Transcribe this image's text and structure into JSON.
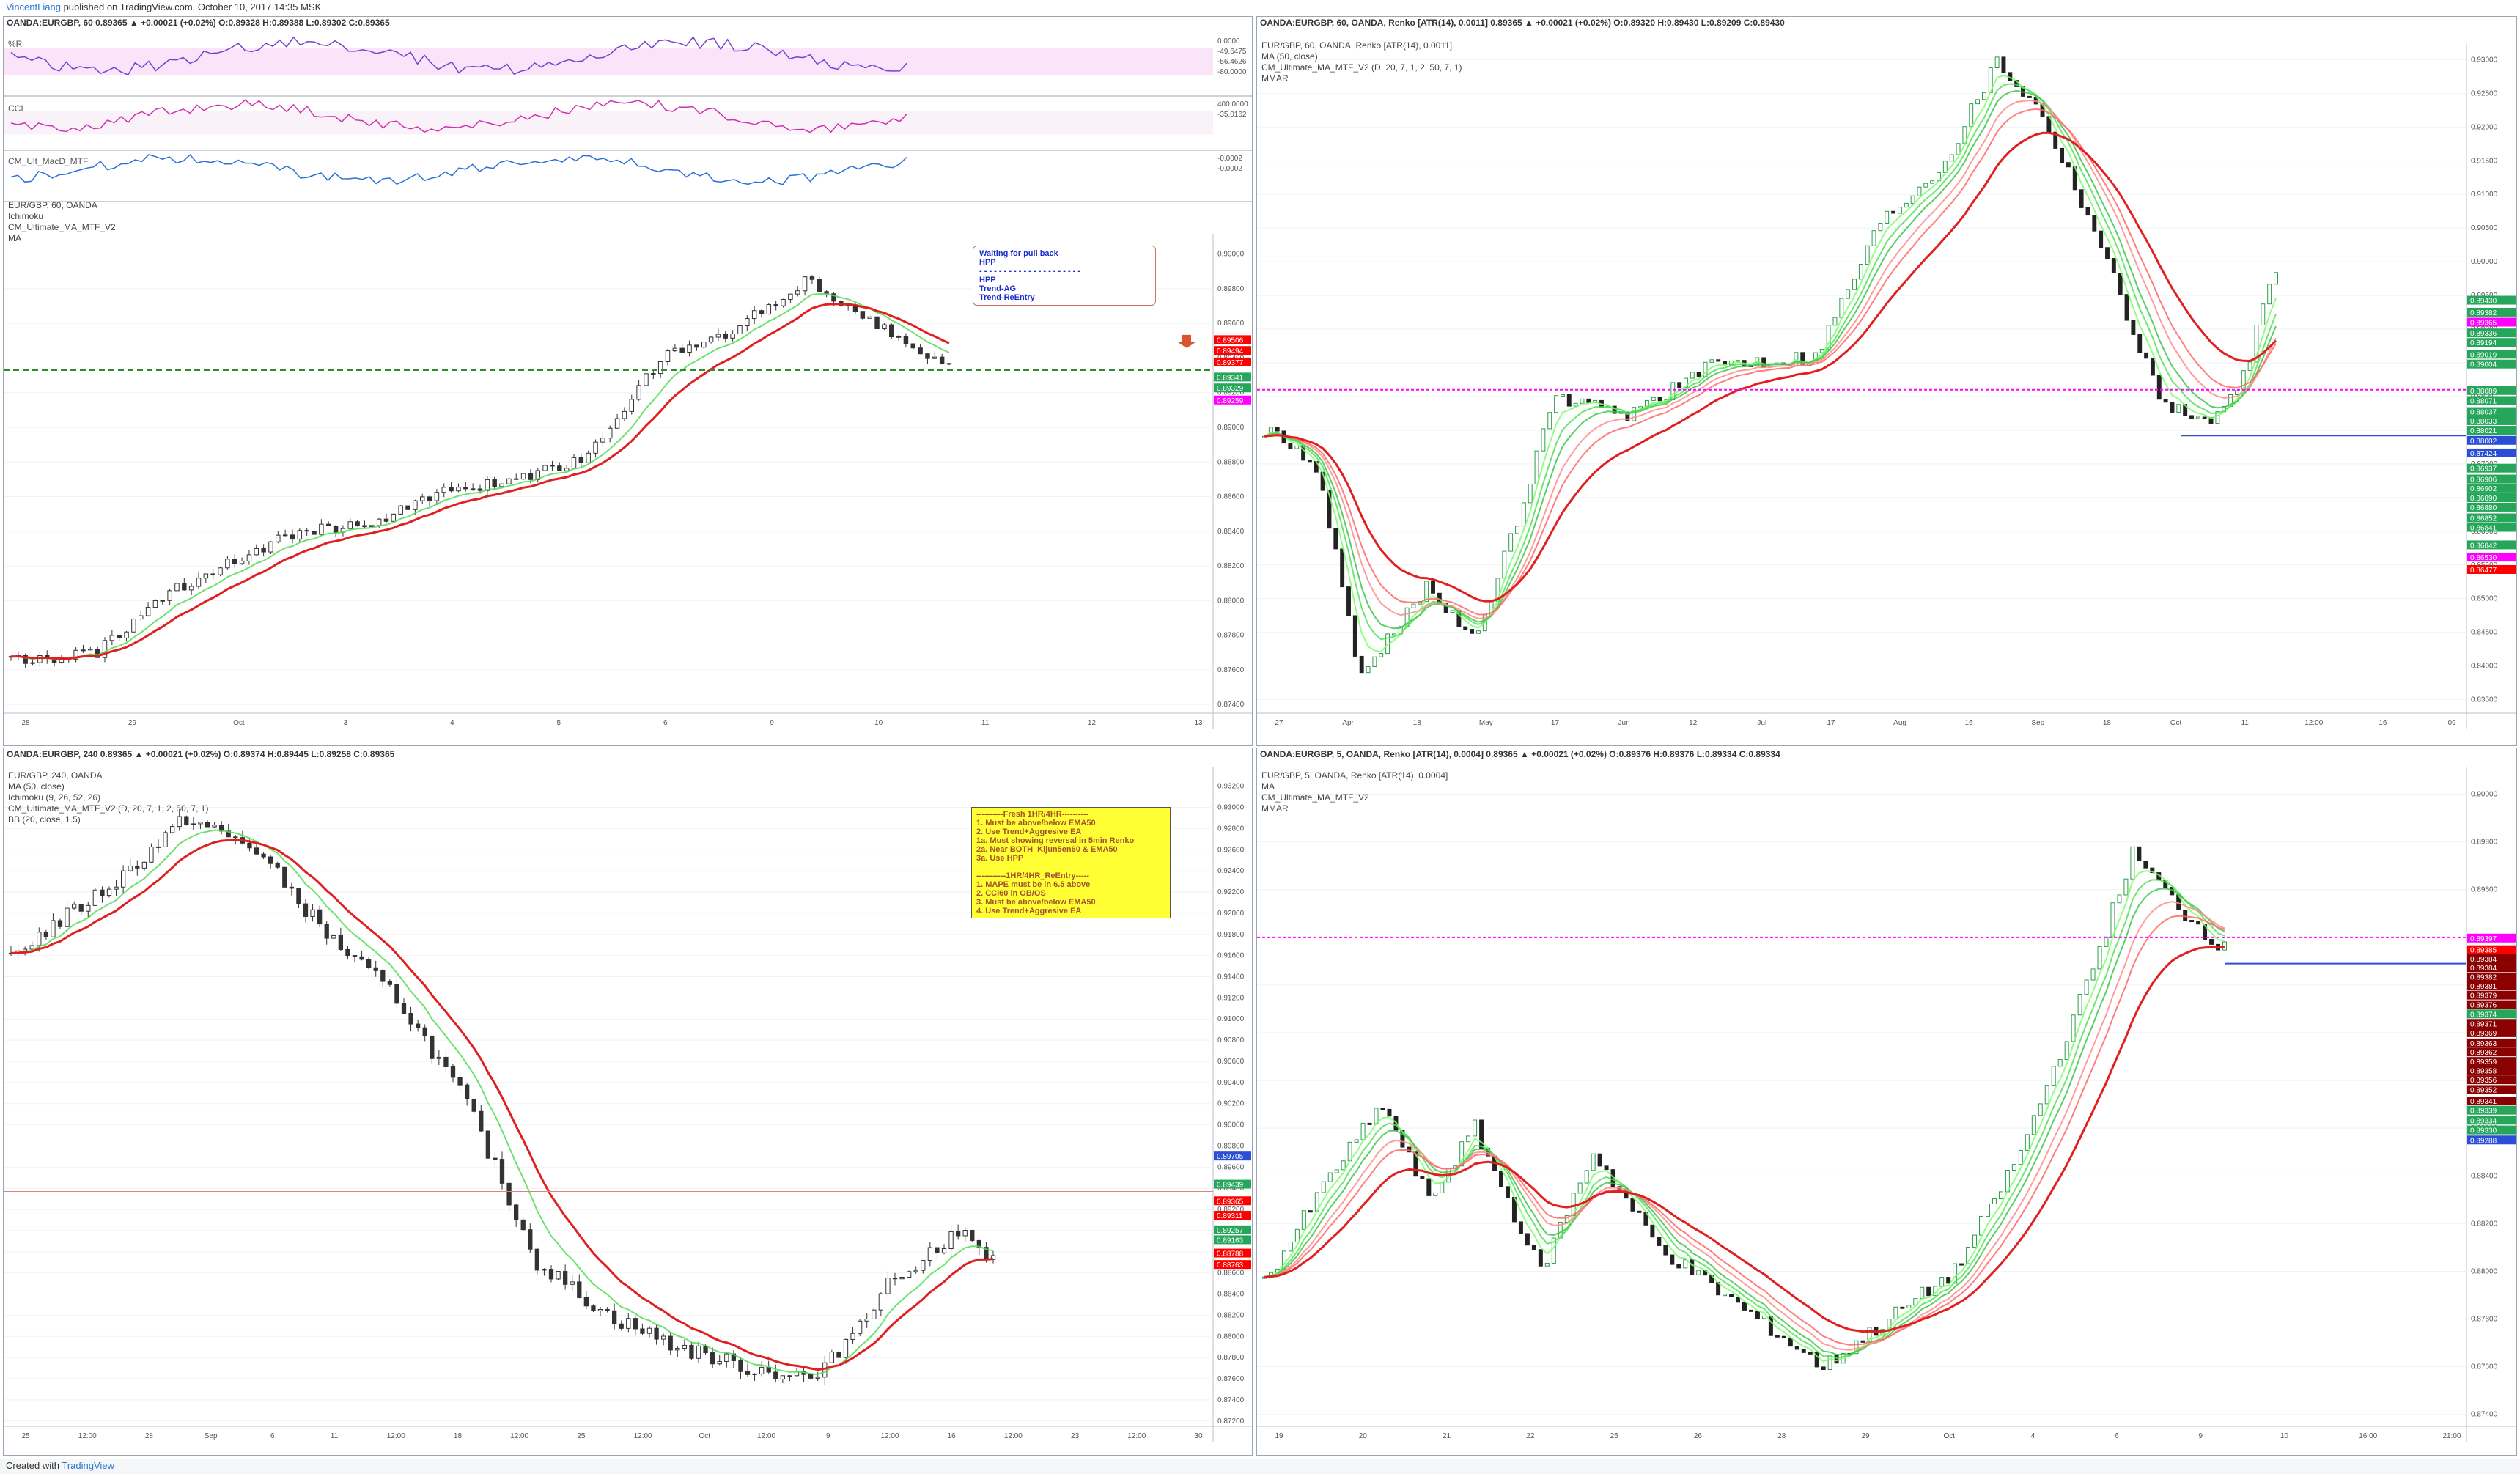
{
  "header": {
    "user": "VincentLiang",
    "text": "published on TradingView.com, October 10, 2017 14:35 MSK"
  },
  "footer": {
    "created": "Created with",
    "brand": "TradingView"
  },
  "panels": {
    "tl": {
      "ohlc": "OANDA:EURGBP, 60 0.89365 ▲ +0.00021 (+0.02%) O:0.89328 H:0.89388 L:0.89302 C:0.89365",
      "legend": [
        "EUR/GBP, 60, OANDA",
        "Ichimoku",
        "CM_Ultimate_MA_MTF_V2",
        "MA"
      ],
      "sub": {
        "wr": "%R",
        "cci": "CCI",
        "macd": "CM_Ult_MacD_MTF"
      },
      "note": "Waiting for pull back\nHPP\n- - - - - - - - - - - - - - - - - - - - -\nHPP\nTrend-AG\nTrend-ReEntry"
    },
    "tr": {
      "ohlc": "OANDA:EURGBP, 60, OANDA, Renko [ATR(14), 0.0011] 0.89365 ▲ +0.00021 (+0.02%) O:0.89320 H:0.89430 L:0.89209 C:0.89430",
      "legend": [
        "EUR/GBP, 60, OANDA, Renko [ATR(14), 0.0011]",
        "MA (50, close)",
        "CM_Ultimate_MA_MTF_V2 (D, 20, 7, 1, 2, 50, 7, 1)",
        "MMAR"
      ]
    },
    "bl": {
      "ohlc": "OANDA:EURGBP, 240 0.89365 ▲ +0.00021 (+0.02%) O:0.89374 H:0.89445 L:0.89258 C:0.89365",
      "legend": [
        "EUR/GBP, 240, OANDA",
        "MA (50, close)",
        "Ichimoku (9, 26, 52, 26)",
        "CM_Ultimate_MA_MTF_V2 (D, 20, 7, 1, 2, 50, 7, 1)",
        "BB (20, close, 1.5)"
      ],
      "note": "----------Fresh 1HR/4HR----------\n1. Must be above/below EMA50\n2. Use Trend+Aggresive EA\n1a. Must showing reversal in 5min Renko\n2a. Near BOTH  Kijun5en60 & EMA50\n3a. Use HPP\n\n-----------1HR/4HR_ReEntry-----\n1. MAPE must be in 6.5 above\n2. CCI60 in OB/OS\n3. Must be above/below EMA50\n4. Use Trend+Aggresive EA"
    },
    "br": {
      "ohlc": "OANDA:EURGBP, 5, OANDA, Renko [ATR(14), 0.0004] 0.89365 ▲ +0.00021 (+0.02%) O:0.89376 H:0.89376 L:0.89334 C:0.89334",
      "legend": [
        "EUR/GBP, 5, OANDA, Renko [ATR(14), 0.0004]",
        "MA",
        "CM_Ultimate_MA_MTF_V2",
        "MMAR"
      ]
    }
  },
  "chart_data": [
    {
      "id": "tl",
      "type": "candlestick",
      "ylim": [
        0.8735,
        0.901
      ],
      "y_ticks": [
        "0.90000",
        "0.89800",
        "0.89600",
        "0.89400",
        "0.89200",
        "0.89000",
        "0.88800",
        "0.88600",
        "0.88400",
        "0.88200",
        "0.88000",
        "0.87800",
        "0.87600",
        "0.87400"
      ],
      "y_tick_values": [
        0.9,
        0.898,
        0.896,
        0.894,
        0.892,
        0.89,
        0.888,
        0.886,
        0.884,
        0.882,
        0.88,
        0.878,
        0.876,
        0.874
      ],
      "x_ticks": [
        "28",
        "29",
        "Oct",
        "3",
        "4",
        "5",
        "6",
        "9",
        "10",
        "11",
        "12",
        "13"
      ],
      "keypoints": [
        [
          0,
          0.8765
        ],
        [
          12,
          0.877
        ],
        [
          20,
          0.88
        ],
        [
          30,
          0.8822
        ],
        [
          40,
          0.884
        ],
        [
          50,
          0.8845
        ],
        [
          60,
          0.8862
        ],
        [
          70,
          0.887
        ],
        [
          80,
          0.8883
        ],
        [
          90,
          0.894
        ],
        [
          100,
          0.8955
        ],
        [
          110,
          0.8985
        ],
        [
          120,
          0.896
        ],
        [
          130,
          0.8935
        ]
      ],
      "price_labels": [
        {
          "v": 0.89506,
          "t": "0.89506",
          "c": "#ff0000"
        },
        {
          "v": 0.89494,
          "t": "0.89494",
          "c": "#ff0000"
        },
        {
          "v": 0.89377,
          "t": "0.89377",
          "c": "#ff0000"
        },
        {
          "v": 0.89341,
          "t": "0.89341",
          "c": "#26a65b"
        },
        {
          "v": 0.89329,
          "t": "0.89329",
          "c": "#26a65b"
        },
        {
          "v": 0.89259,
          "t": "0.89259",
          "c": "#ff00ff"
        }
      ],
      "subcharts": {
        "wr": {
          "ticks": [
            "0.0000",
            "-49.6475",
            "-56.4626",
            "-80.0000"
          ]
        },
        "cci": {
          "ticks": [
            "400.0000",
            "-35.0162"
          ]
        },
        "macd": {
          "ticks": [
            "-0.0002",
            "-0.0002"
          ]
        }
      }
    },
    {
      "id": "tr",
      "type": "renko",
      "ylim": [
        0.833,
        0.932
      ],
      "y_ticks": [
        "0.93000",
        "0.92500",
        "0.92000",
        "0.91500",
        "0.91000",
        "0.90500",
        "0.90000",
        "0.89500",
        "0.89000",
        "0.88500",
        "0.88000",
        "0.87500",
        "0.87000",
        "0.86500",
        "0.86000",
        "0.85500",
        "0.85000",
        "0.84500",
        "0.84000",
        "0.83500"
      ],
      "y_tick_values": [
        0.93,
        0.925,
        0.92,
        0.915,
        0.91,
        0.905,
        0.9,
        0.895,
        0.89,
        0.885,
        0.88,
        0.875,
        0.87,
        0.865,
        0.86,
        0.855,
        0.85,
        0.845,
        0.84,
        0.835
      ],
      "x_ticks": [
        "27",
        "Apr",
        "18",
        "May",
        "17",
        "Jun",
        "12",
        "Jul",
        "17",
        "Aug",
        "16",
        "Sep",
        "18",
        "Oct",
        "11",
        "12:00",
        "16",
        "09"
      ],
      "keypoints": [
        [
          0,
          0.875
        ],
        [
          8,
          0.87
        ],
        [
          15,
          0.838
        ],
        [
          25,
          0.852
        ],
        [
          33,
          0.844
        ],
        [
          45,
          0.88
        ],
        [
          55,
          0.877
        ],
        [
          70,
          0.885
        ],
        [
          85,
          0.886
        ],
        [
          95,
          0.906
        ],
        [
          105,
          0.915
        ],
        [
          113,
          0.93
        ],
        [
          120,
          0.922
        ],
        [
          128,
          0.905
        ],
        [
          138,
          0.88
        ],
        [
          145,
          0.876
        ],
        [
          150,
          0.88
        ],
        [
          156,
          0.899
        ]
      ],
      "price_labels": [
        {
          "v": 0.8943,
          "t": "0.89430",
          "c": "#26a65b"
        },
        {
          "v": 0.89382,
          "t": "0.89382",
          "c": "#26a65b"
        },
        {
          "v": 0.89365,
          "t": "0.89365",
          "c": "#ff00ff"
        },
        {
          "v": 0.89336,
          "t": "0.89336",
          "c": "#26a65b"
        },
        {
          "v": 0.89194,
          "t": "0.89194",
          "c": "#26a65b"
        },
        {
          "v": 0.89019,
          "t": "0.89019",
          "c": "#26a65b"
        },
        {
          "v": 0.89004,
          "t": "0.89004",
          "c": "#26a65b"
        },
        {
          "v": 0.88089,
          "t": "0.88089",
          "c": "#26a65b"
        },
        {
          "v": 0.88071,
          "t": "0.88071",
          "c": "#26a65b"
        },
        {
          "v": 0.88037,
          "t": "0.88037",
          "c": "#26a65b"
        },
        {
          "v": 0.88033,
          "t": "0.88033",
          "c": "#26a65b"
        },
        {
          "v": 0.88021,
          "t": "0.88021",
          "c": "#26a65b"
        },
        {
          "v": 0.88002,
          "t": "0.88002",
          "c": "#2a4fd6"
        },
        {
          "v": 0.86937,
          "t": "0.86937",
          "c": "#26a65b"
        },
        {
          "v": 0.86906,
          "t": "0.86906",
          "c": "#26a65b"
        },
        {
          "v": 0.86902,
          "t": "0.86902",
          "c": "#26a65b"
        },
        {
          "v": 0.8689,
          "t": "0.86890",
          "c": "#26a65b"
        },
        {
          "v": 0.8688,
          "t": "0.86880",
          "c": "#26a65b"
        },
        {
          "v": 0.86852,
          "t": "0.86852",
          "c": "#26a65b"
        },
        {
          "v": 0.86841,
          "t": "0.86841",
          "c": "#26a65b"
        },
        {
          "v": 0.86842,
          "t": "0.86842",
          "c": "#26a65b"
        },
        {
          "v": 0.8653,
          "t": "0.86530",
          "c": "#ff00ff"
        },
        {
          "v": 0.86477,
          "t": "0.86477",
          "c": "#ff0000"
        },
        {
          "v": 0.87424,
          "t": "0.87424",
          "c": "#2a4fd6"
        }
      ]
    },
    {
      "id": "bl",
      "type": "candlestick",
      "ylim": [
        0.8715,
        0.9335
      ],
      "y_ticks": [
        "0.93200",
        "0.93000",
        "0.92800",
        "0.92600",
        "0.92400",
        "0.92200",
        "0.92000",
        "0.91800",
        "0.91600",
        "0.91400",
        "0.91200",
        "0.91000",
        "0.90800",
        "0.90600",
        "0.90400",
        "0.90200",
        "0.90000",
        "0.89800",
        "0.89600",
        "0.89400",
        "0.89200",
        "0.89000",
        "0.88800",
        "0.88600",
        "0.88400",
        "0.88200",
        "0.88000",
        "0.87800",
        "0.87600",
        "0.87400",
        "0.87200"
      ],
      "y_tick_values": [
        0.932,
        0.93,
        0.928,
        0.926,
        0.924,
        0.922,
        0.92,
        0.918,
        0.916,
        0.914,
        0.912,
        0.91,
        0.908,
        0.906,
        0.904,
        0.902,
        0.9,
        0.898,
        0.896,
        0.894,
        0.892,
        0.89,
        0.888,
        0.886,
        0.884,
        0.882,
        0.88,
        0.878,
        0.876,
        0.874,
        0.872
      ],
      "x_ticks": [
        "25",
        "12:00",
        "28",
        "Sep",
        "6",
        "11",
        "12:00",
        "18",
        "12:00",
        "25",
        "12:00",
        "Oct",
        "12:00",
        "9",
        "12:00",
        "16",
        "12:00",
        "23",
        "12:00",
        "30"
      ],
      "keypoints": [
        [
          0,
          0.916
        ],
        [
          15,
          0.923
        ],
        [
          25,
          0.929
        ],
        [
          35,
          0.926
        ],
        [
          45,
          0.918
        ],
        [
          55,
          0.912
        ],
        [
          65,
          0.902
        ],
        [
          75,
          0.887
        ],
        [
          85,
          0.882
        ],
        [
          95,
          0.879
        ],
        [
          105,
          0.877
        ],
        [
          115,
          0.876
        ],
        [
          125,
          0.885
        ],
        [
          135,
          0.89
        ],
        [
          140,
          0.887
        ]
      ],
      "price_labels": [
        {
          "v": 0.89705,
          "t": "0.89705",
          "c": "#2a4fd6"
        },
        {
          "v": 0.89439,
          "t": "0.89439",
          "c": "#26a65b"
        },
        {
          "v": 0.89365,
          "t": "0.89365",
          "c": "#ff0000"
        },
        {
          "v": 0.89311,
          "t": "0.89311",
          "c": "#ff0000"
        },
        {
          "v": 0.89257,
          "t": "0.89257",
          "c": "#26a65b"
        },
        {
          "v": 0.89163,
          "t": "0.89163",
          "c": "#26a65b"
        },
        {
          "v": 0.88788,
          "t": "0.88788",
          "c": "#ff0000"
        },
        {
          "v": 0.88763,
          "t": "0.88763",
          "c": "#ff0000"
        }
      ]
    },
    {
      "id": "br",
      "type": "renko",
      "ylim": [
        0.8735,
        0.901
      ],
      "y_ticks": [
        "0.90000",
        "0.89800",
        "0.89600",
        "0.89400",
        "0.89200",
        "0.89000",
        "0.88800",
        "0.88600",
        "0.88400",
        "0.88200",
        "0.88000",
        "0.87800",
        "0.87600",
        "0.87400"
      ],
      "y_tick_values": [
        0.9,
        0.898,
        0.896,
        0.894,
        0.892,
        0.89,
        0.888,
        0.886,
        0.884,
        0.882,
        0.88,
        0.878,
        0.876,
        0.874
      ],
      "x_ticks": [
        "19",
        "20",
        "21",
        "22",
        "25",
        "26",
        "28",
        "29",
        "Oct",
        "4",
        "6",
        "9",
        "10",
        "16:00",
        "21:00"
      ],
      "keypoints": [
        [
          0,
          0.8795
        ],
        [
          10,
          0.884
        ],
        [
          18,
          0.887
        ],
        [
          25,
          0.883
        ],
        [
          32,
          0.886
        ],
        [
          42,
          0.88
        ],
        [
          50,
          0.885
        ],
        [
          60,
          0.881
        ],
        [
          70,
          0.879
        ],
        [
          85,
          0.876
        ],
        [
          95,
          0.878
        ],
        [
          105,
          0.88
        ],
        [
          115,
          0.885
        ],
        [
          125,
          0.892
        ],
        [
          132,
          0.8975
        ],
        [
          140,
          0.895
        ],
        [
          146,
          0.8935
        ]
      ],
      "price_labels": [
        {
          "v": 0.89397,
          "t": "0.89397",
          "c": "#ff00ff"
        },
        {
          "v": 0.89385,
          "t": "0.89385",
          "c": "#ff0000"
        },
        {
          "v": 0.89384,
          "t": "0.89384",
          "c": "#8b0000"
        },
        {
          "v": 0.89384,
          "t": "0.89384",
          "c": "#8b0000"
        },
        {
          "v": 0.89382,
          "t": "0.89382",
          "c": "#8b0000"
        },
        {
          "v": 0.89381,
          "t": "0.89381",
          "c": "#8b0000"
        },
        {
          "v": 0.89379,
          "t": "0.89379",
          "c": "#8b0000"
        },
        {
          "v": 0.89376,
          "t": "0.89376",
          "c": "#8b0000"
        },
        {
          "v": 0.89374,
          "t": "0.89374",
          "c": "#26a65b"
        },
        {
          "v": 0.89371,
          "t": "0.89371",
          "c": "#8b0000"
        },
        {
          "v": 0.89369,
          "t": "0.89369",
          "c": "#8b0000"
        },
        {
          "v": 0.89363,
          "t": "0.89363",
          "c": "#8b0000"
        },
        {
          "v": 0.89362,
          "t": "0.89362",
          "c": "#8b0000"
        },
        {
          "v": 0.89359,
          "t": "0.89359",
          "c": "#8b0000"
        },
        {
          "v": 0.89358,
          "t": "0.89358",
          "c": "#8b0000"
        },
        {
          "v": 0.89356,
          "t": "0.89356",
          "c": "#8b0000"
        },
        {
          "v": 0.89352,
          "t": "0.89352",
          "c": "#8b0000"
        },
        {
          "v": 0.89341,
          "t": "0.89341",
          "c": "#8b0000"
        },
        {
          "v": 0.89339,
          "t": "0.89339",
          "c": "#26a65b"
        },
        {
          "v": 0.89334,
          "t": "0.89334",
          "c": "#26a65b"
        },
        {
          "v": 0.8933,
          "t": "0.89330",
          "c": "#26a65b"
        },
        {
          "v": 0.89288,
          "t": "0.89288",
          "c": "#2a4fd6"
        }
      ]
    }
  ]
}
